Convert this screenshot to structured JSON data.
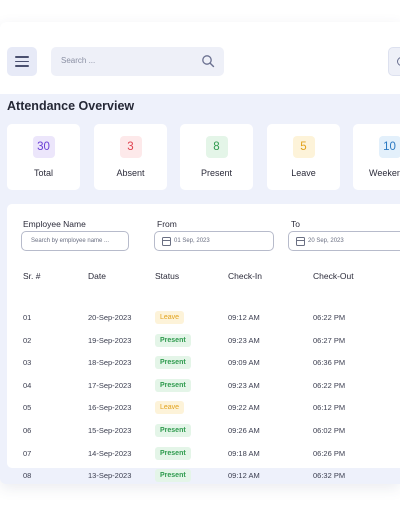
{
  "search": {
    "placeholder": "Search ..."
  },
  "page_title": "Attendance Overview",
  "stats": [
    {
      "value": "30",
      "label": "Total"
    },
    {
      "value": "3",
      "label": "Absent"
    },
    {
      "value": "8",
      "label": "Present"
    },
    {
      "value": "5",
      "label": "Leave"
    },
    {
      "value": "10",
      "label": "Weeken"
    }
  ],
  "filters": {
    "employee_label": "Employee Name",
    "employee_placeholder": "Search by employee name ...",
    "from_label": "From",
    "from_value": "01 Sep, 2023",
    "to_label": "To",
    "to_value": "20 Sep, 2023"
  },
  "table": {
    "headers": [
      "Sr. #",
      "Date",
      "Status",
      "Check-In",
      "Check-Out"
    ],
    "rows": [
      {
        "sr": "01",
        "date": "20-Sep-2023",
        "status": "Leave",
        "in": "09:12 AM",
        "out": "06:22 PM"
      },
      {
        "sr": "02",
        "date": "19-Sep-2023",
        "status": "Present",
        "in": "09:23 AM",
        "out": "06:27 PM"
      },
      {
        "sr": "03",
        "date": "18-Sep-2023",
        "status": "Present",
        "in": "09:09 AM",
        "out": "06:36 PM"
      },
      {
        "sr": "04",
        "date": "17-Sep-2023",
        "status": "Present",
        "in": "09:23 AM",
        "out": "06:22 PM"
      },
      {
        "sr": "05",
        "date": "16-Sep-2023",
        "status": "Leave",
        "in": "09:22 AM",
        "out": "06:12 PM"
      },
      {
        "sr": "06",
        "date": "15-Sep-2023",
        "status": "Present",
        "in": "09:26 AM",
        "out": "06:02 PM"
      },
      {
        "sr": "07",
        "date": "14-Sep-2023",
        "status": "Present",
        "in": "09:18 AM",
        "out": "06:26 PM"
      },
      {
        "sr": "08",
        "date": "13-Sep-2023",
        "status": "Present",
        "in": "09:12 AM",
        "out": "06:32 PM"
      }
    ]
  },
  "colors": {
    "background": "#eef1fb",
    "leave": "#e2a21b",
    "present": "#2f9b4e",
    "absent": "#e0424f",
    "total": "#6b3fd6",
    "weekend": "#2b79c2"
  },
  "icons": [
    "menu-icon",
    "search-icon",
    "calendar-icon"
  ]
}
